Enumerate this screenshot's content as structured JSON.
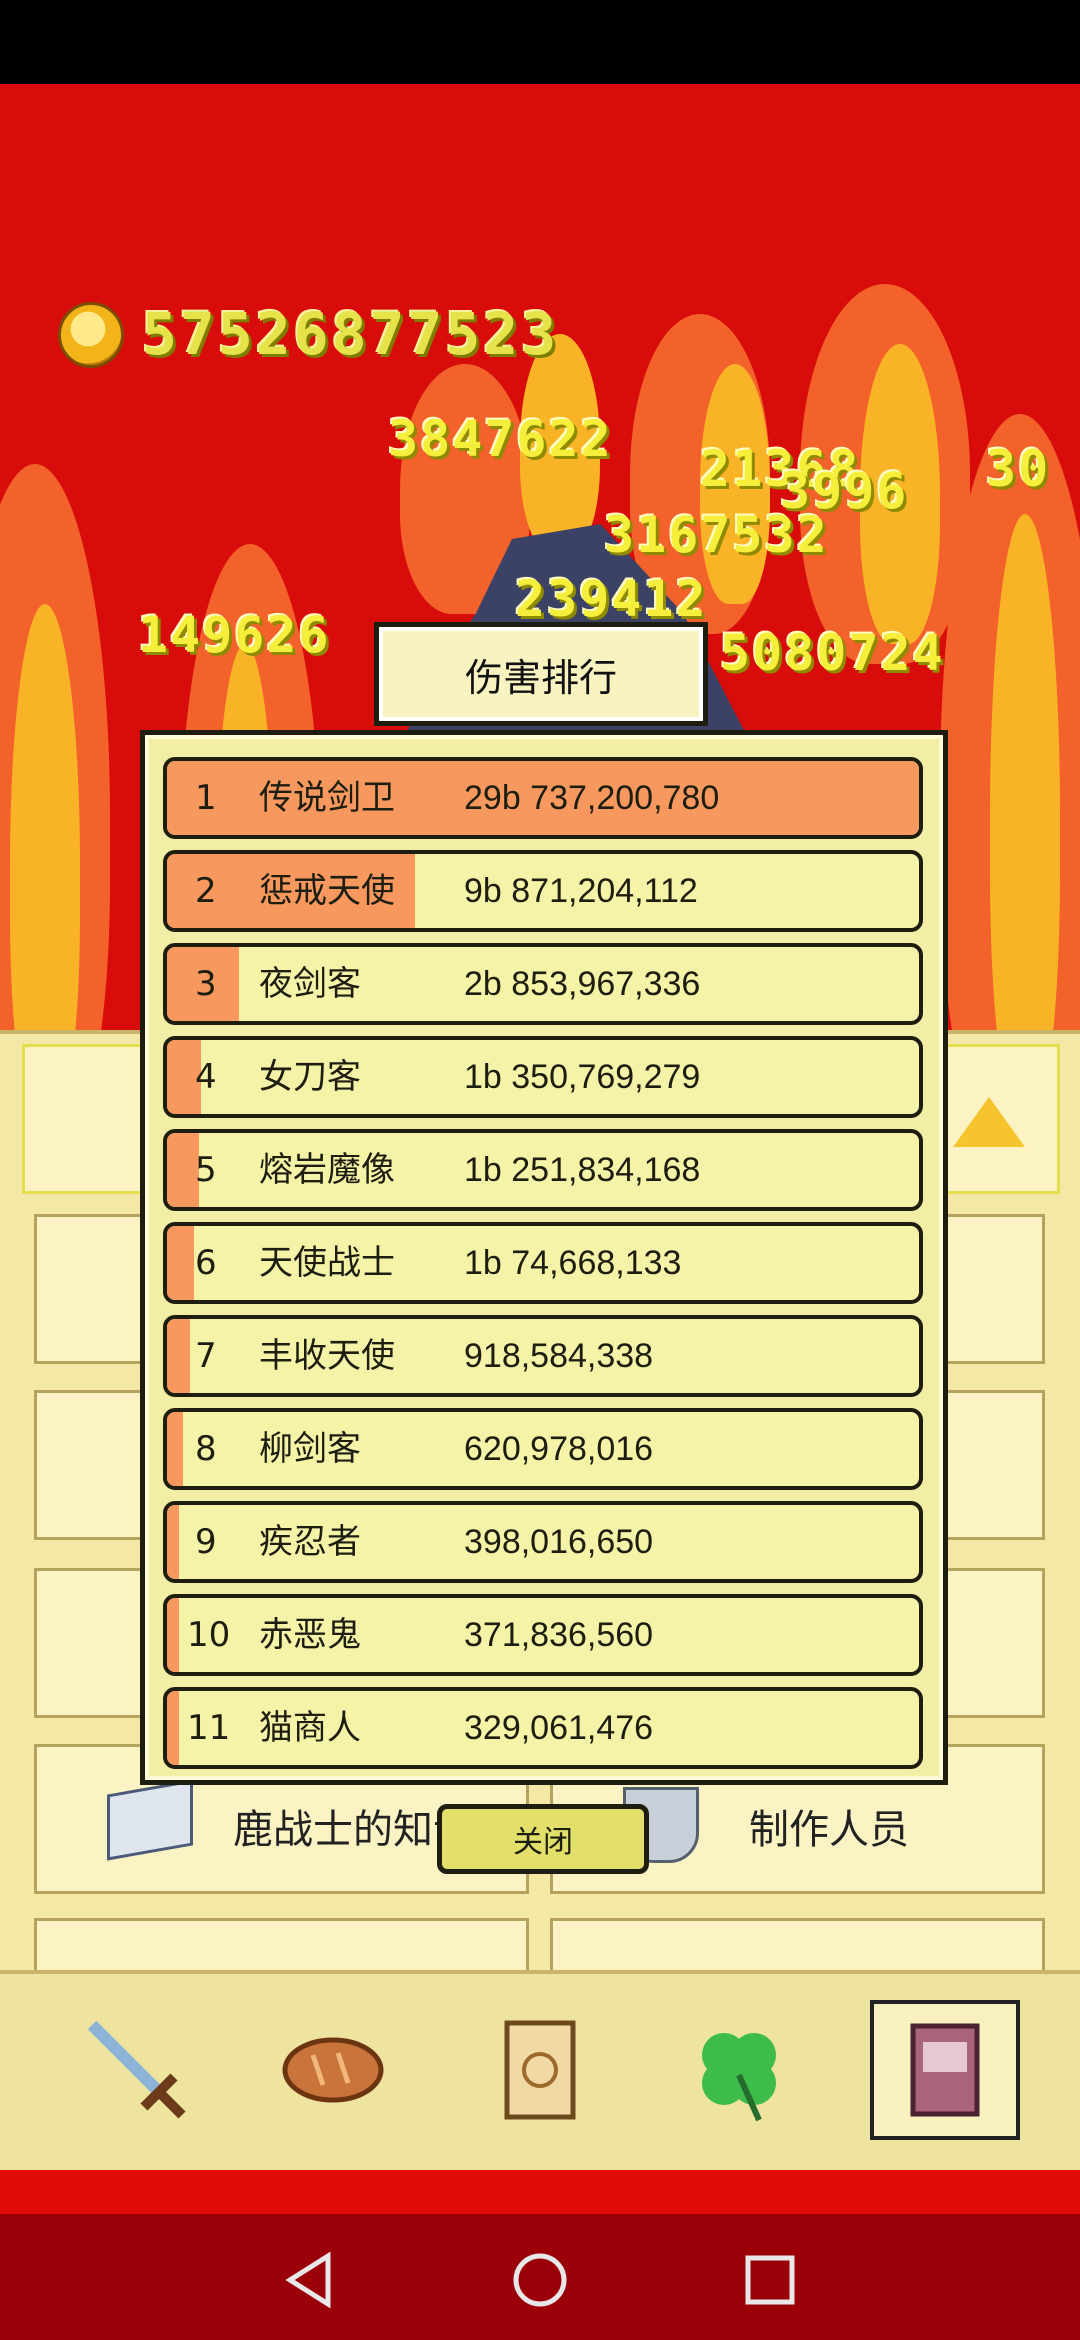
{
  "hud": {
    "coins": "57526877523"
  },
  "floating_damage": [
    "3847622",
    "21368",
    "3996",
    "30",
    "3167532",
    "239412",
    "149626",
    "5080724"
  ],
  "ranking": {
    "title": "伤害排行",
    "rows": [
      {
        "rank": "1",
        "name": "传说剑卫",
        "damage": "29b 737,200,780",
        "share": 1.0
      },
      {
        "rank": "2",
        "name": "惩戒天使",
        "damage": "9b 871,204,112",
        "share": 0.33
      },
      {
        "rank": "3",
        "name": "夜剑客",
        "damage": "2b 853,967,336",
        "share": 0.096
      },
      {
        "rank": "4",
        "name": "女刀客",
        "damage": "1b 350,769,279",
        "share": 0.045
      },
      {
        "rank": "5",
        "name": "熔岩魔像",
        "damage": "1b 251,834,168",
        "share": 0.042
      },
      {
        "rank": "6",
        "name": "天使战士",
        "damage": "1b 74,668,133",
        "share": 0.036
      },
      {
        "rank": "7",
        "name": "丰收天使",
        "damage": "918,584,338",
        "share": 0.031
      },
      {
        "rank": "8",
        "name": "柳剑客",
        "damage": "620,978,016",
        "share": 0.021
      },
      {
        "rank": "9",
        "name": "疾忍者",
        "damage": "398,016,650",
        "share": 0.013
      },
      {
        "rank": "10",
        "name": "赤恶鬼",
        "damage": "371,836,560",
        "share": 0.0125
      },
      {
        "rank": "11",
        "name": "猫商人",
        "damage": "329,061,476",
        "share": 0.011
      }
    ],
    "close_label": "关闭"
  },
  "panel": {
    "knowledge_label": "鹿战士的知识",
    "credits_label": "制作人员"
  },
  "tabs": [
    "sword-icon",
    "bread-icon",
    "scroll-icon",
    "clover-icon",
    "book-icon"
  ],
  "colors": {
    "bar_fill": "#f7995f",
    "row_bg": "#f5f3a8",
    "game_bg": "#d80c0a"
  }
}
